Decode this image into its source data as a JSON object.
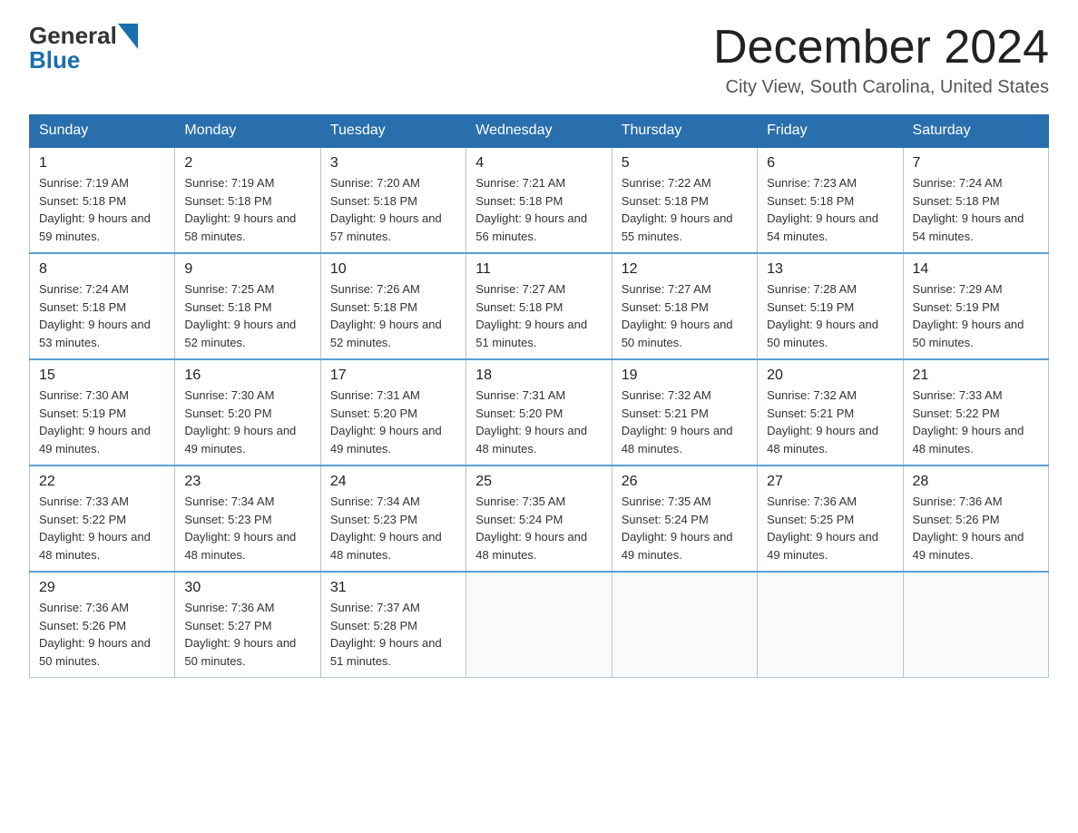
{
  "header": {
    "logo_general": "General",
    "logo_blue": "Blue",
    "month_title": "December 2024",
    "location": "City View, South Carolina, United States"
  },
  "weekdays": [
    "Sunday",
    "Monday",
    "Tuesday",
    "Wednesday",
    "Thursday",
    "Friday",
    "Saturday"
  ],
  "weeks": [
    [
      {
        "day": "1",
        "sunrise": "7:19 AM",
        "sunset": "5:18 PM",
        "daylight": "9 hours and 59 minutes."
      },
      {
        "day": "2",
        "sunrise": "7:19 AM",
        "sunset": "5:18 PM",
        "daylight": "9 hours and 58 minutes."
      },
      {
        "day": "3",
        "sunrise": "7:20 AM",
        "sunset": "5:18 PM",
        "daylight": "9 hours and 57 minutes."
      },
      {
        "day": "4",
        "sunrise": "7:21 AM",
        "sunset": "5:18 PM",
        "daylight": "9 hours and 56 minutes."
      },
      {
        "day": "5",
        "sunrise": "7:22 AM",
        "sunset": "5:18 PM",
        "daylight": "9 hours and 55 minutes."
      },
      {
        "day": "6",
        "sunrise": "7:23 AM",
        "sunset": "5:18 PM",
        "daylight": "9 hours and 54 minutes."
      },
      {
        "day": "7",
        "sunrise": "7:24 AM",
        "sunset": "5:18 PM",
        "daylight": "9 hours and 54 minutes."
      }
    ],
    [
      {
        "day": "8",
        "sunrise": "7:24 AM",
        "sunset": "5:18 PM",
        "daylight": "9 hours and 53 minutes."
      },
      {
        "day": "9",
        "sunrise": "7:25 AM",
        "sunset": "5:18 PM",
        "daylight": "9 hours and 52 minutes."
      },
      {
        "day": "10",
        "sunrise": "7:26 AM",
        "sunset": "5:18 PM",
        "daylight": "9 hours and 52 minutes."
      },
      {
        "day": "11",
        "sunrise": "7:27 AM",
        "sunset": "5:18 PM",
        "daylight": "9 hours and 51 minutes."
      },
      {
        "day": "12",
        "sunrise": "7:27 AM",
        "sunset": "5:18 PM",
        "daylight": "9 hours and 50 minutes."
      },
      {
        "day": "13",
        "sunrise": "7:28 AM",
        "sunset": "5:19 PM",
        "daylight": "9 hours and 50 minutes."
      },
      {
        "day": "14",
        "sunrise": "7:29 AM",
        "sunset": "5:19 PM",
        "daylight": "9 hours and 50 minutes."
      }
    ],
    [
      {
        "day": "15",
        "sunrise": "7:30 AM",
        "sunset": "5:19 PM",
        "daylight": "9 hours and 49 minutes."
      },
      {
        "day": "16",
        "sunrise": "7:30 AM",
        "sunset": "5:20 PM",
        "daylight": "9 hours and 49 minutes."
      },
      {
        "day": "17",
        "sunrise": "7:31 AM",
        "sunset": "5:20 PM",
        "daylight": "9 hours and 49 minutes."
      },
      {
        "day": "18",
        "sunrise": "7:31 AM",
        "sunset": "5:20 PM",
        "daylight": "9 hours and 48 minutes."
      },
      {
        "day": "19",
        "sunrise": "7:32 AM",
        "sunset": "5:21 PM",
        "daylight": "9 hours and 48 minutes."
      },
      {
        "day": "20",
        "sunrise": "7:32 AM",
        "sunset": "5:21 PM",
        "daylight": "9 hours and 48 minutes."
      },
      {
        "day": "21",
        "sunrise": "7:33 AM",
        "sunset": "5:22 PM",
        "daylight": "9 hours and 48 minutes."
      }
    ],
    [
      {
        "day": "22",
        "sunrise": "7:33 AM",
        "sunset": "5:22 PM",
        "daylight": "9 hours and 48 minutes."
      },
      {
        "day": "23",
        "sunrise": "7:34 AM",
        "sunset": "5:23 PM",
        "daylight": "9 hours and 48 minutes."
      },
      {
        "day": "24",
        "sunrise": "7:34 AM",
        "sunset": "5:23 PM",
        "daylight": "9 hours and 48 minutes."
      },
      {
        "day": "25",
        "sunrise": "7:35 AM",
        "sunset": "5:24 PM",
        "daylight": "9 hours and 48 minutes."
      },
      {
        "day": "26",
        "sunrise": "7:35 AM",
        "sunset": "5:24 PM",
        "daylight": "9 hours and 49 minutes."
      },
      {
        "day": "27",
        "sunrise": "7:36 AM",
        "sunset": "5:25 PM",
        "daylight": "9 hours and 49 minutes."
      },
      {
        "day": "28",
        "sunrise": "7:36 AM",
        "sunset": "5:26 PM",
        "daylight": "9 hours and 49 minutes."
      }
    ],
    [
      {
        "day": "29",
        "sunrise": "7:36 AM",
        "sunset": "5:26 PM",
        "daylight": "9 hours and 50 minutes."
      },
      {
        "day": "30",
        "sunrise": "7:36 AM",
        "sunset": "5:27 PM",
        "daylight": "9 hours and 50 minutes."
      },
      {
        "day": "31",
        "sunrise": "7:37 AM",
        "sunset": "5:28 PM",
        "daylight": "9 hours and 51 minutes."
      },
      null,
      null,
      null,
      null
    ]
  ],
  "colors": {
    "header_bg": "#2a6fad",
    "header_text": "#ffffff",
    "border": "#5a9fd4",
    "cell_border": "#b0c4de"
  }
}
